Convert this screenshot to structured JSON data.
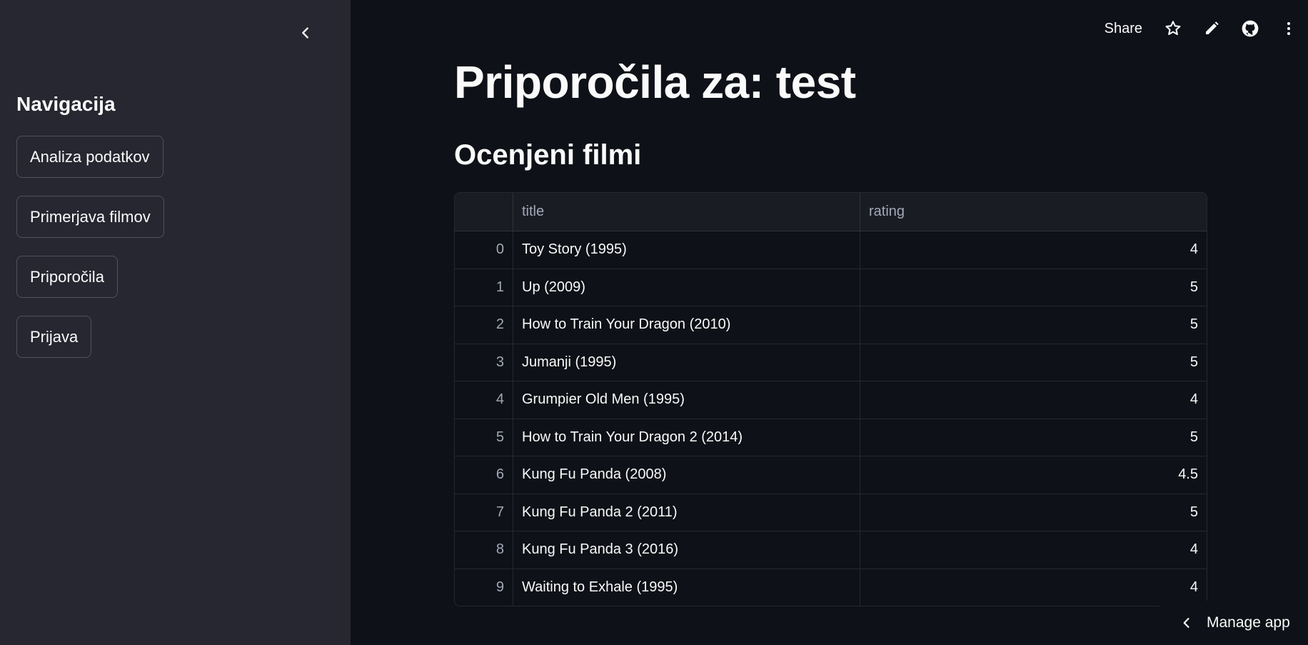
{
  "sidebar": {
    "nav_title": "Navigacija",
    "items": [
      {
        "label": "Analiza podatkov"
      },
      {
        "label": "Primerjava filmov"
      },
      {
        "label": "Priporočila"
      },
      {
        "label": "Prijava"
      }
    ]
  },
  "toolbar": {
    "share_label": "Share",
    "icons": [
      "star-icon",
      "pencil-icon",
      "github-icon",
      "more-vertical-icon"
    ]
  },
  "main": {
    "page_title": "Priporočila za: test",
    "section_title": "Ocenjeni filmi",
    "table": {
      "columns": [
        "",
        "title",
        "rating"
      ],
      "rows": [
        {
          "index": "0",
          "title": "Toy Story (1995)",
          "rating": "4"
        },
        {
          "index": "1",
          "title": "Up (2009)",
          "rating": "5"
        },
        {
          "index": "2",
          "title": "How to Train Your Dragon (2010)",
          "rating": "5"
        },
        {
          "index": "3",
          "title": "Jumanji (1995)",
          "rating": "5"
        },
        {
          "index": "4",
          "title": "Grumpier Old Men (1995)",
          "rating": "4"
        },
        {
          "index": "5",
          "title": "How to Train Your Dragon 2 (2014)",
          "rating": "5"
        },
        {
          "index": "6",
          "title": "Kung Fu Panda (2008)",
          "rating": "4.5"
        },
        {
          "index": "7",
          "title": "Kung Fu Panda 2 (2011)",
          "rating": "5"
        },
        {
          "index": "8",
          "title": "Kung Fu Panda 3 (2016)",
          "rating": "4"
        },
        {
          "index": "9",
          "title": "Waiting to Exhale (1995)",
          "rating": "4"
        }
      ]
    }
  },
  "footer": {
    "manage_label": "Manage app"
  },
  "colors": {
    "background": "#0e1117",
    "sidebar": "#262730",
    "text": "#fafafa",
    "muted": "#a3a8b8"
  }
}
